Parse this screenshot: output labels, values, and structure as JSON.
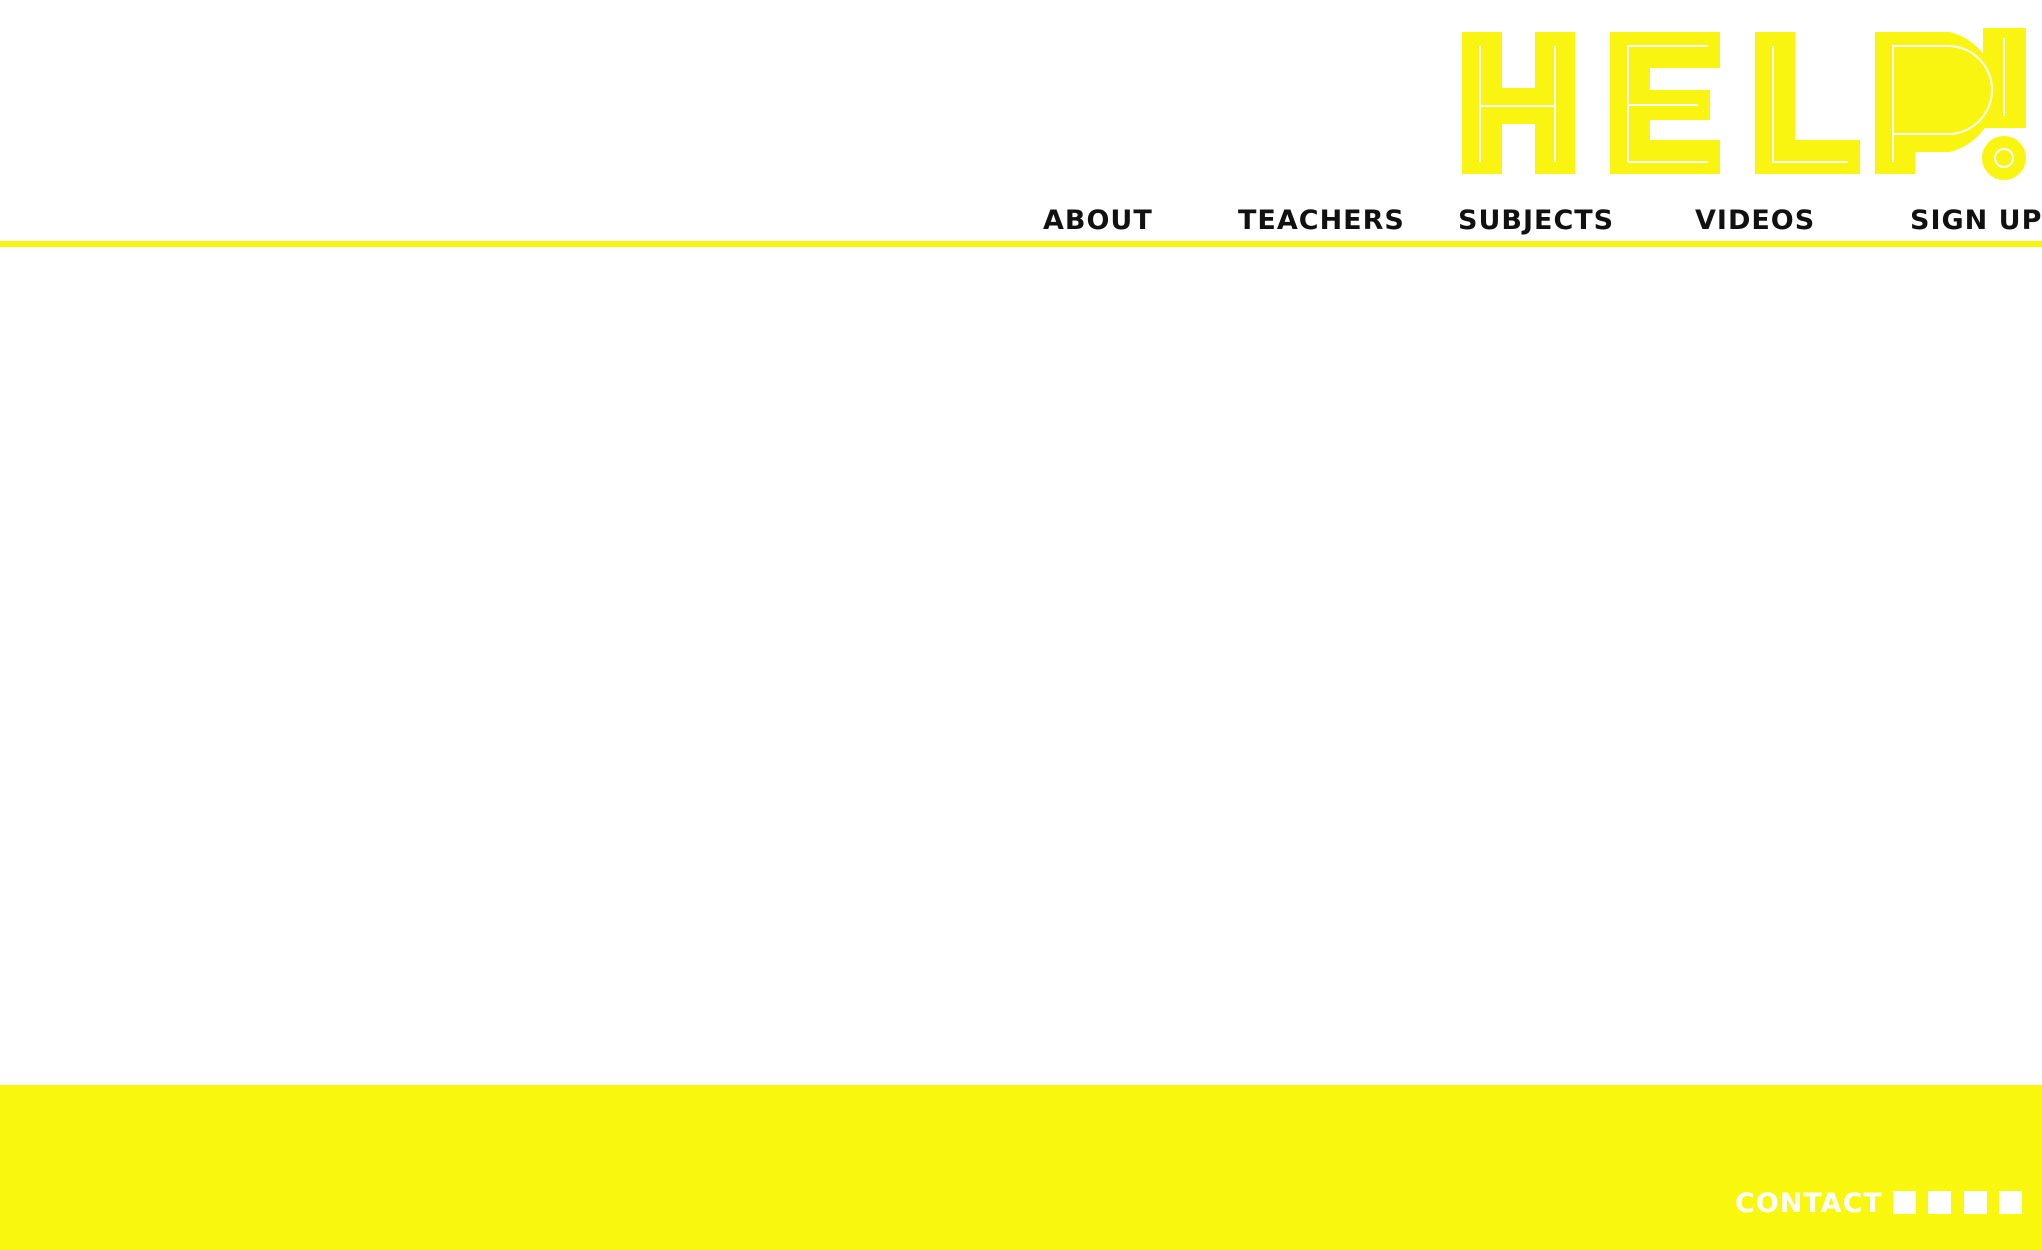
{
  "brand": {
    "logo_text": "HELP!",
    "accent_color": "#f9f510"
  },
  "nav": {
    "items": [
      {
        "label": "ABOUT"
      },
      {
        "label": "TEACHERS"
      },
      {
        "label": "SUBJECTS"
      },
      {
        "label": "VIDEOS"
      },
      {
        "label": "SIGN UP"
      }
    ]
  },
  "footer": {
    "contact_label": "CONTACT",
    "social_icons": [
      "social-icon-1",
      "social-icon-2",
      "social-icon-3",
      "social-icon-4"
    ],
    "background_color": "#f9f70e"
  }
}
